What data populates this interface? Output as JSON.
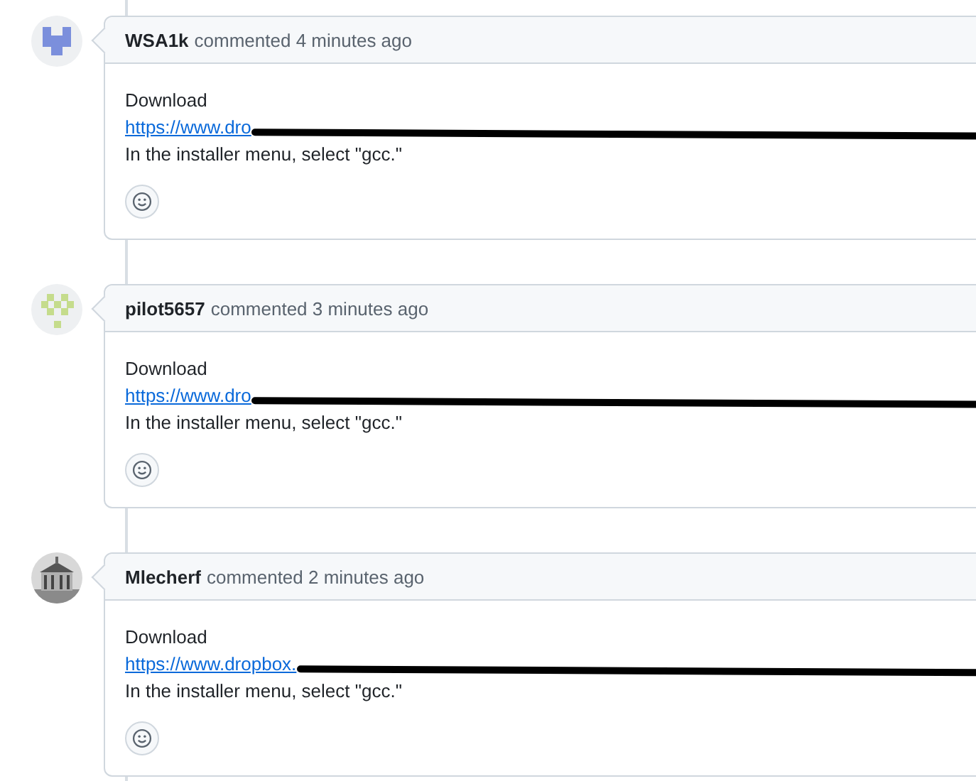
{
  "comments": [
    {
      "avatar": {
        "kind": "identicon",
        "color": "#7b8fdc"
      },
      "author": "WSA1k",
      "meta": "commented 4 minutes ago",
      "lines": [
        "Download"
      ],
      "link": {
        "text": "https://www.dro",
        "redacted": true
      },
      "after": "In the installer menu, select \"gcc.\""
    },
    {
      "avatar": {
        "kind": "checker",
        "color": "#c5dc8c"
      },
      "author": "pilot5657",
      "meta": "commented 3 minutes ago",
      "lines": [
        "Download"
      ],
      "link": {
        "text": "https://www.dro",
        "redacted": true
      },
      "after": "In the installer menu, select \"gcc.\""
    },
    {
      "author": "Mlecherf",
      "meta": "commented 2 minutes ago",
      "lines": [
        "Download"
      ],
      "link": {
        "text": "https://www.dropbox.",
        "redacted": true
      },
      "after": "In the installer menu, select \"gcc.\""
    }
  ]
}
